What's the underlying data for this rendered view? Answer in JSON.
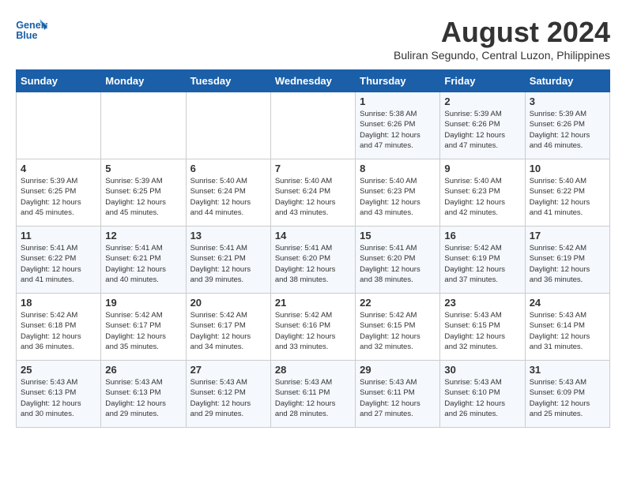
{
  "logo": {
    "line1": "General",
    "line2": "Blue"
  },
  "title": "August 2024",
  "location": "Buliran Segundo, Central Luzon, Philippines",
  "days_of_week": [
    "Sunday",
    "Monday",
    "Tuesday",
    "Wednesday",
    "Thursday",
    "Friday",
    "Saturday"
  ],
  "weeks": [
    [
      {
        "day": "",
        "info": ""
      },
      {
        "day": "",
        "info": ""
      },
      {
        "day": "",
        "info": ""
      },
      {
        "day": "",
        "info": ""
      },
      {
        "day": "1",
        "info": "Sunrise: 5:38 AM\nSunset: 6:26 PM\nDaylight: 12 hours\nand 47 minutes."
      },
      {
        "day": "2",
        "info": "Sunrise: 5:39 AM\nSunset: 6:26 PM\nDaylight: 12 hours\nand 47 minutes."
      },
      {
        "day": "3",
        "info": "Sunrise: 5:39 AM\nSunset: 6:26 PM\nDaylight: 12 hours\nand 46 minutes."
      }
    ],
    [
      {
        "day": "4",
        "info": "Sunrise: 5:39 AM\nSunset: 6:25 PM\nDaylight: 12 hours\nand 45 minutes."
      },
      {
        "day": "5",
        "info": "Sunrise: 5:39 AM\nSunset: 6:25 PM\nDaylight: 12 hours\nand 45 minutes."
      },
      {
        "day": "6",
        "info": "Sunrise: 5:40 AM\nSunset: 6:24 PM\nDaylight: 12 hours\nand 44 minutes."
      },
      {
        "day": "7",
        "info": "Sunrise: 5:40 AM\nSunset: 6:24 PM\nDaylight: 12 hours\nand 43 minutes."
      },
      {
        "day": "8",
        "info": "Sunrise: 5:40 AM\nSunset: 6:23 PM\nDaylight: 12 hours\nand 43 minutes."
      },
      {
        "day": "9",
        "info": "Sunrise: 5:40 AM\nSunset: 6:23 PM\nDaylight: 12 hours\nand 42 minutes."
      },
      {
        "day": "10",
        "info": "Sunrise: 5:40 AM\nSunset: 6:22 PM\nDaylight: 12 hours\nand 41 minutes."
      }
    ],
    [
      {
        "day": "11",
        "info": "Sunrise: 5:41 AM\nSunset: 6:22 PM\nDaylight: 12 hours\nand 41 minutes."
      },
      {
        "day": "12",
        "info": "Sunrise: 5:41 AM\nSunset: 6:21 PM\nDaylight: 12 hours\nand 40 minutes."
      },
      {
        "day": "13",
        "info": "Sunrise: 5:41 AM\nSunset: 6:21 PM\nDaylight: 12 hours\nand 39 minutes."
      },
      {
        "day": "14",
        "info": "Sunrise: 5:41 AM\nSunset: 6:20 PM\nDaylight: 12 hours\nand 38 minutes."
      },
      {
        "day": "15",
        "info": "Sunrise: 5:41 AM\nSunset: 6:20 PM\nDaylight: 12 hours\nand 38 minutes."
      },
      {
        "day": "16",
        "info": "Sunrise: 5:42 AM\nSunset: 6:19 PM\nDaylight: 12 hours\nand 37 minutes."
      },
      {
        "day": "17",
        "info": "Sunrise: 5:42 AM\nSunset: 6:19 PM\nDaylight: 12 hours\nand 36 minutes."
      }
    ],
    [
      {
        "day": "18",
        "info": "Sunrise: 5:42 AM\nSunset: 6:18 PM\nDaylight: 12 hours\nand 36 minutes."
      },
      {
        "day": "19",
        "info": "Sunrise: 5:42 AM\nSunset: 6:17 PM\nDaylight: 12 hours\nand 35 minutes."
      },
      {
        "day": "20",
        "info": "Sunrise: 5:42 AM\nSunset: 6:17 PM\nDaylight: 12 hours\nand 34 minutes."
      },
      {
        "day": "21",
        "info": "Sunrise: 5:42 AM\nSunset: 6:16 PM\nDaylight: 12 hours\nand 33 minutes."
      },
      {
        "day": "22",
        "info": "Sunrise: 5:42 AM\nSunset: 6:15 PM\nDaylight: 12 hours\nand 32 minutes."
      },
      {
        "day": "23",
        "info": "Sunrise: 5:43 AM\nSunset: 6:15 PM\nDaylight: 12 hours\nand 32 minutes."
      },
      {
        "day": "24",
        "info": "Sunrise: 5:43 AM\nSunset: 6:14 PM\nDaylight: 12 hours\nand 31 minutes."
      }
    ],
    [
      {
        "day": "25",
        "info": "Sunrise: 5:43 AM\nSunset: 6:13 PM\nDaylight: 12 hours\nand 30 minutes."
      },
      {
        "day": "26",
        "info": "Sunrise: 5:43 AM\nSunset: 6:13 PM\nDaylight: 12 hours\nand 29 minutes."
      },
      {
        "day": "27",
        "info": "Sunrise: 5:43 AM\nSunset: 6:12 PM\nDaylight: 12 hours\nand 29 minutes."
      },
      {
        "day": "28",
        "info": "Sunrise: 5:43 AM\nSunset: 6:11 PM\nDaylight: 12 hours\nand 28 minutes."
      },
      {
        "day": "29",
        "info": "Sunrise: 5:43 AM\nSunset: 6:11 PM\nDaylight: 12 hours\nand 27 minutes."
      },
      {
        "day": "30",
        "info": "Sunrise: 5:43 AM\nSunset: 6:10 PM\nDaylight: 12 hours\nand 26 minutes."
      },
      {
        "day": "31",
        "info": "Sunrise: 5:43 AM\nSunset: 6:09 PM\nDaylight: 12 hours\nand 25 minutes."
      }
    ]
  ]
}
